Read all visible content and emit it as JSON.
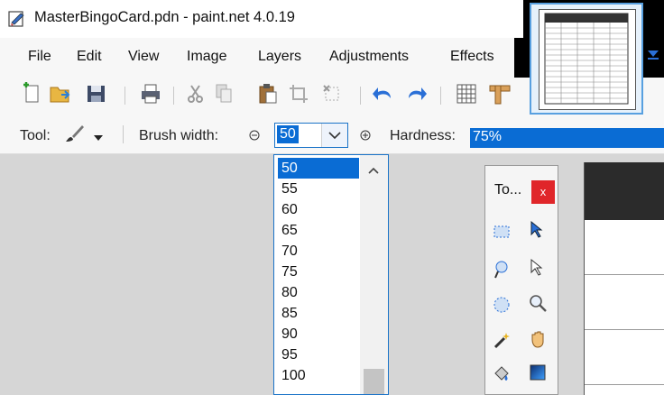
{
  "window": {
    "title": "MasterBingoCard.pdn - paint.net 4.0.19"
  },
  "menu": [
    "File",
    "Edit",
    "View",
    "Image",
    "Layers",
    "Adjustments",
    "Effects"
  ],
  "toolbar": {
    "icons": [
      "new-image-icon",
      "open-file-icon",
      "save-icon",
      "print-icon",
      "cut-icon",
      "copy-icon",
      "paste-icon",
      "crop-to-selection-icon",
      "deselect-icon",
      "undo-icon",
      "redo-icon",
      "grid-icon",
      "ruler-icon"
    ]
  },
  "options": {
    "tool_label": "Tool:",
    "brush_width_label": "Brush width:",
    "brush_width_value": "50",
    "hardness_label": "Hardness:",
    "hardness_value": "75%"
  },
  "brush_width_options": [
    "50",
    "55",
    "60",
    "65",
    "70",
    "75",
    "80",
    "85",
    "90",
    "95",
    "100"
  ],
  "brush_width_selected": "50",
  "tools_window": {
    "title": "To...",
    "close_label": "x",
    "tools": [
      "rectangle-select-icon",
      "move-selected-pixels-icon",
      "lasso-select-icon",
      "move-selection-icon",
      "ellipse-select-icon",
      "zoom-icon",
      "magic-wand-icon",
      "pan-icon",
      "paint-bucket-icon",
      "gradient-icon"
    ]
  },
  "colors": {
    "accent": "#0a6cd4",
    "close": "#e0262a",
    "canvas_bg": "#d6d6d6"
  }
}
